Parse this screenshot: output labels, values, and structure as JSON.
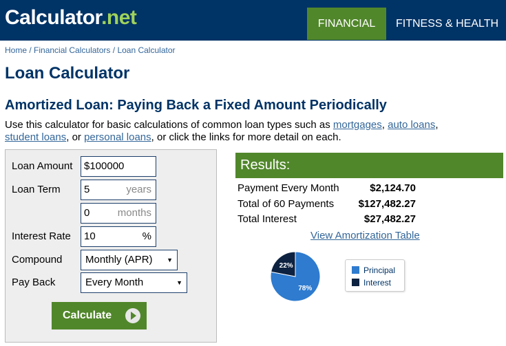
{
  "header": {
    "logo_main": "Calculator",
    "logo_dot": ".",
    "logo_suffix": "net",
    "nav": [
      {
        "label": "FINANCIAL",
        "active": true
      },
      {
        "label": "FITNESS & HEALTH",
        "active": false
      }
    ],
    "colors": {
      "bar": "#003366",
      "active_tab": "#51872b",
      "logo_accent": "#9fd25a"
    }
  },
  "breadcrumb": {
    "items": [
      "Home",
      "Financial Calculators",
      "Loan Calculator"
    ],
    "separator": " / "
  },
  "page_title": "Loan Calculator",
  "section_title": "Amortized Loan: Paying Back a Fixed Amount Periodically",
  "intro": {
    "text_before": "Use this calculator for basic calculations of common loan types such as ",
    "links": [
      "mortgages",
      "auto loans",
      "student loans",
      "personal loans"
    ],
    "sep1": ", ",
    "sep2": ", ",
    "sep3": ", or ",
    "text_after": ", or click the links for more detail on each."
  },
  "form": {
    "loan_amount": {
      "label": "Loan Amount",
      "value": "$100000"
    },
    "loan_term": {
      "label": "Loan Term",
      "years_value": "5",
      "years_unit": "years",
      "months_value": "0",
      "months_unit": "months"
    },
    "interest_rate": {
      "label": "Interest Rate",
      "value": "10",
      "unit": "%"
    },
    "compound": {
      "label": "Compound",
      "selected": "Monthly (APR)"
    },
    "pay_back": {
      "label": "Pay Back",
      "selected": "Every Month"
    },
    "calculate_label": "Calculate"
  },
  "results": {
    "title": "Results:",
    "rows": [
      {
        "label": "Payment Every Month",
        "value": "$2,124.70"
      },
      {
        "label": "Total of 60 Payments",
        "value": "$127,482.27"
      },
      {
        "label": "Total Interest",
        "value": "$27,482.27"
      }
    ],
    "amortization_link": "View Amortization Table",
    "pie": {
      "slices": [
        {
          "name": "Principal",
          "percent": 78,
          "label": "78%",
          "color": "#2e7bcf"
        },
        {
          "name": "Interest",
          "percent": 22,
          "label": "22%",
          "color": "#0d2240"
        }
      ]
    },
    "legend": [
      "Principal",
      "Interest"
    ]
  }
}
